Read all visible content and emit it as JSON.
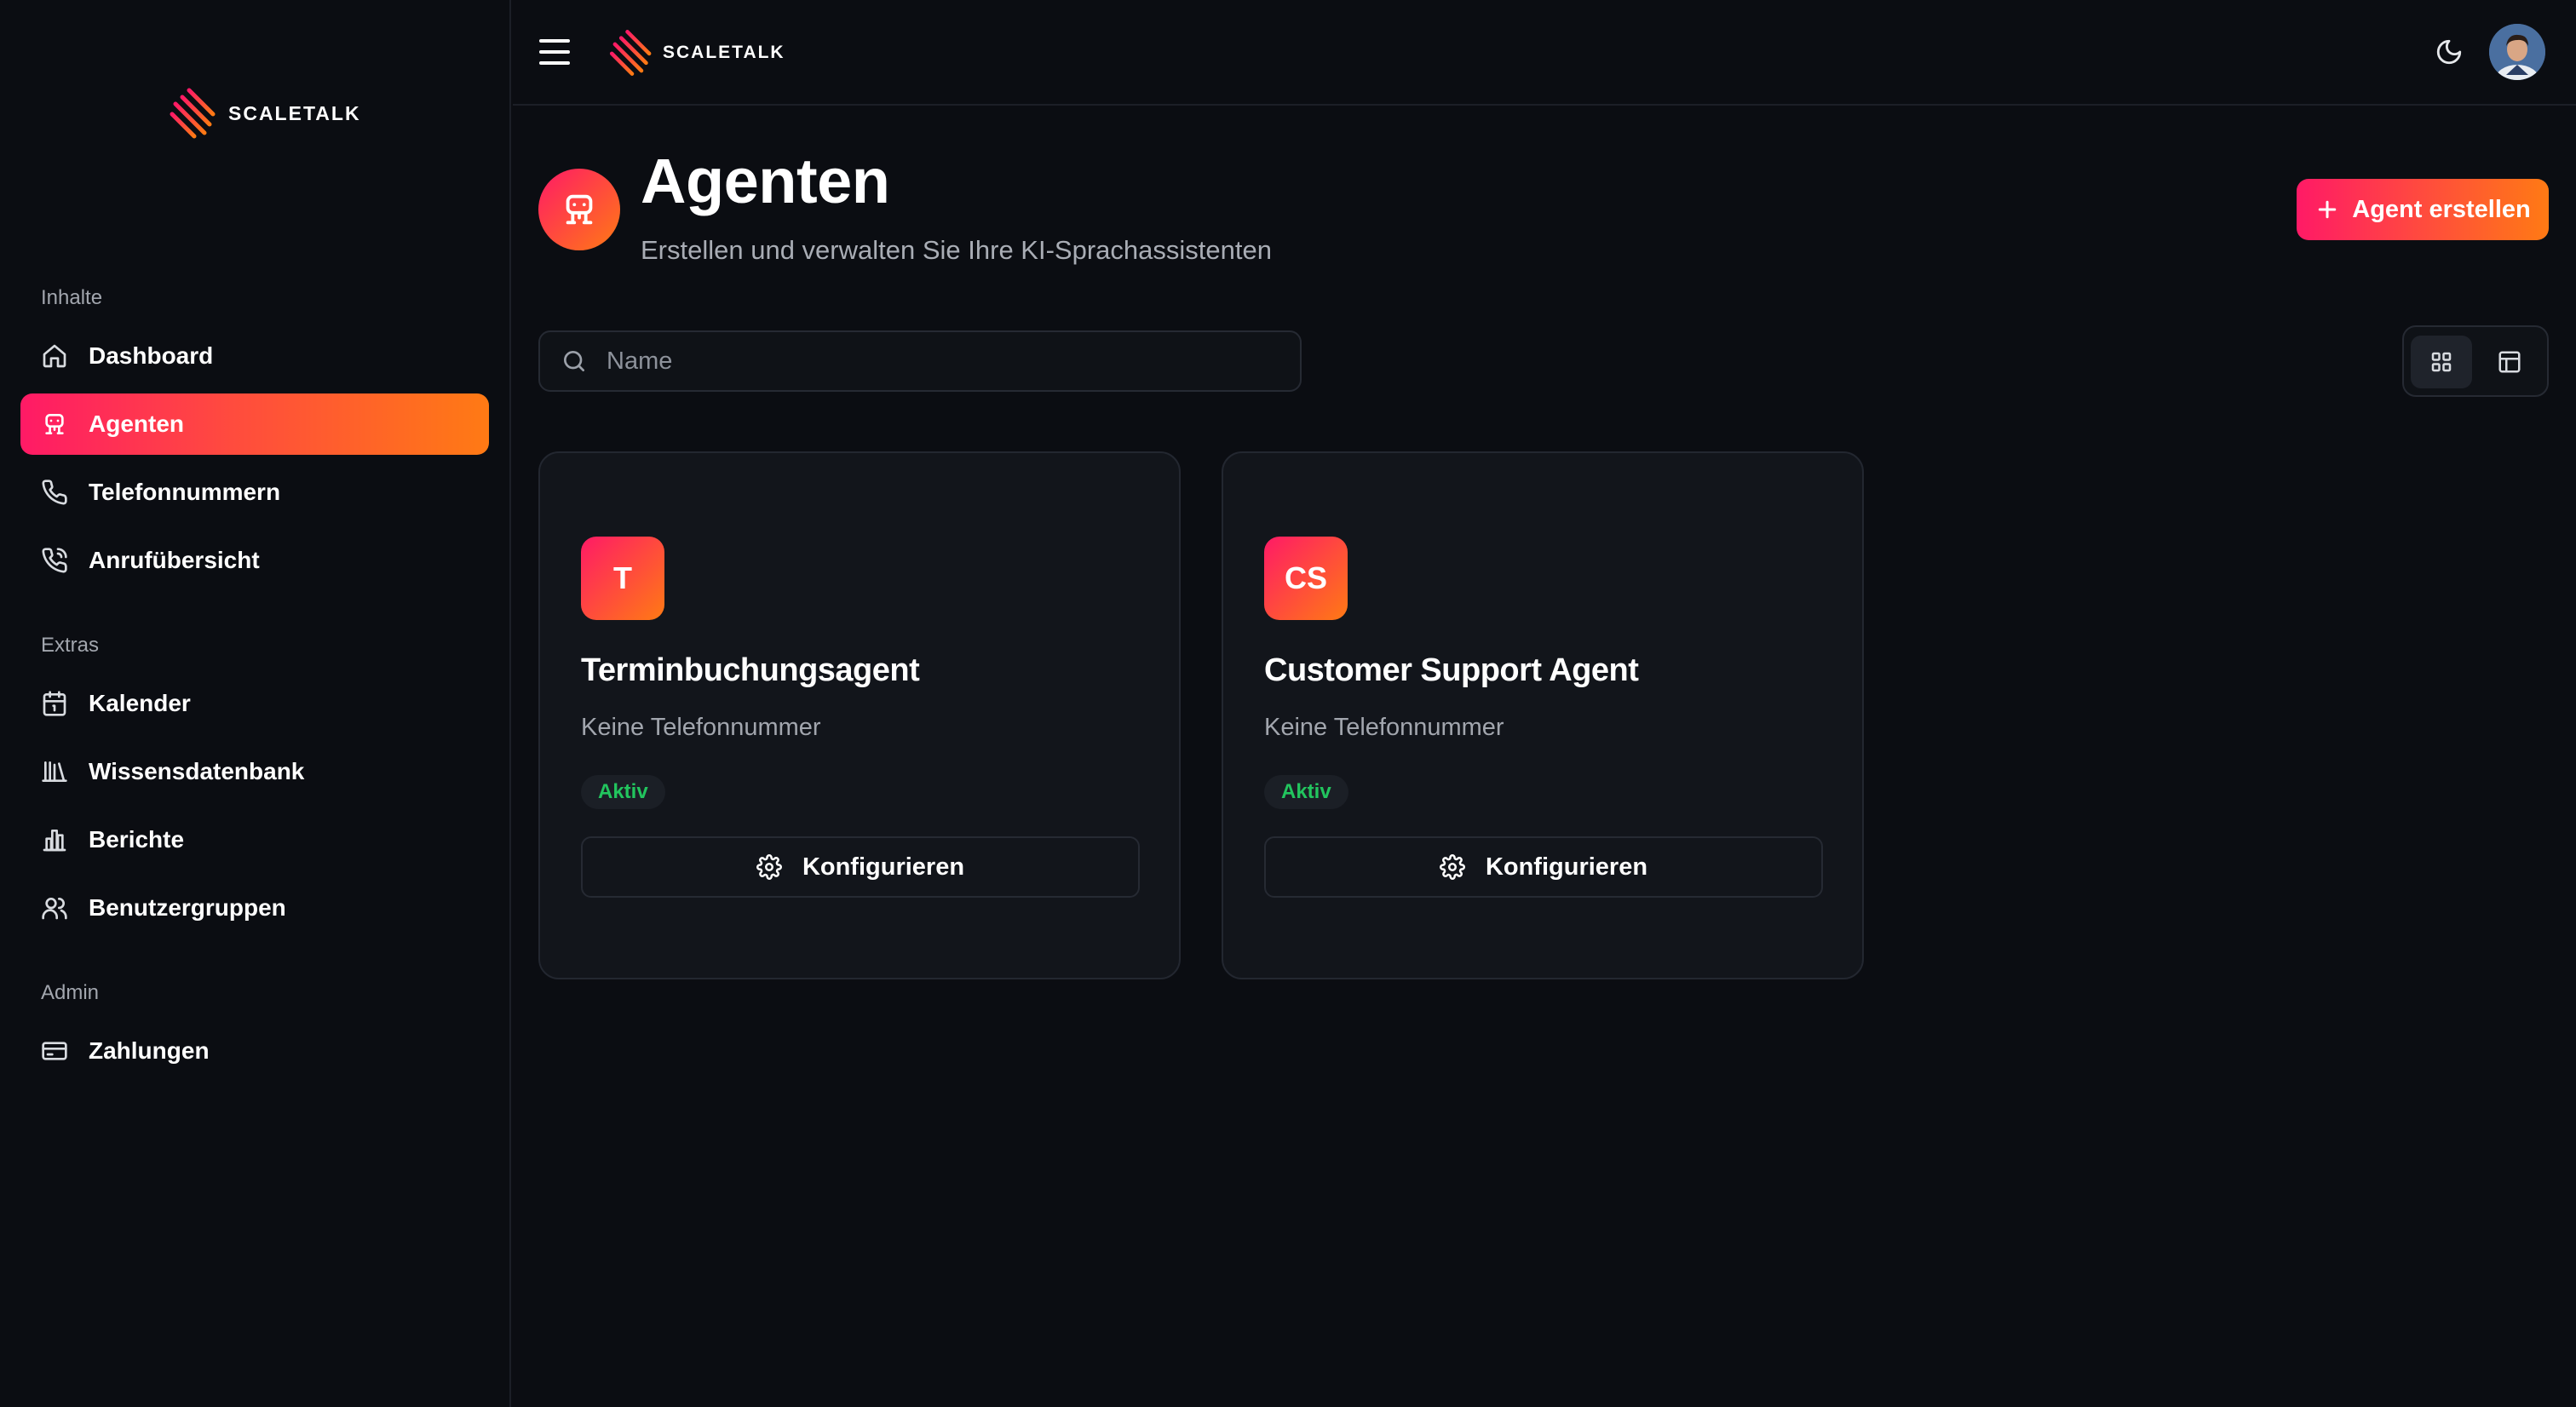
{
  "brand": {
    "name": "SCALETALK"
  },
  "sidebar": {
    "sections": [
      {
        "title": "Inhalte"
      },
      {
        "title": "Extras"
      },
      {
        "title": "Admin"
      }
    ],
    "items": [
      {
        "label": "Dashboard",
        "icon": "home-icon",
        "active": false
      },
      {
        "label": "Agenten",
        "icon": "robot-icon",
        "active": true
      },
      {
        "label": "Telefonnummern",
        "icon": "phone-icon",
        "active": false
      },
      {
        "label": "Anrufübersicht",
        "icon": "phone-call-icon",
        "active": false
      },
      {
        "label": "Kalender",
        "icon": "calendar-icon",
        "active": false
      },
      {
        "label": "Wissensdatenbank",
        "icon": "library-icon",
        "active": false
      },
      {
        "label": "Berichte",
        "icon": "bar-chart-icon",
        "active": false
      },
      {
        "label": "Benutzergruppen",
        "icon": "users-icon",
        "active": false
      },
      {
        "label": "Zahlungen",
        "icon": "credit-card-icon",
        "active": false
      }
    ]
  },
  "header": {
    "title": "Agenten",
    "subtitle": "Erstellen und verwalten Sie Ihre KI-Sprachassistenten",
    "create_label": "Agent erstellen"
  },
  "search": {
    "placeholder": "Name",
    "value": ""
  },
  "view": {
    "mode": "grid"
  },
  "agents": [
    {
      "initials": "T",
      "name": "Terminbuchungsagent",
      "phone": "Keine Telefonnummer",
      "status": "Aktiv",
      "action_label": "Konfigurieren"
    },
    {
      "initials": "CS",
      "name": "Customer Support Agent",
      "phone": "Keine Telefonnummer",
      "status": "Aktiv",
      "action_label": "Konfigurieren"
    }
  ],
  "colors": {
    "accent_start": "#ff1a66",
    "accent_end": "#ff7a14",
    "status_active": "#22c55e",
    "background": "#0b0d12",
    "card": "#12151b"
  }
}
